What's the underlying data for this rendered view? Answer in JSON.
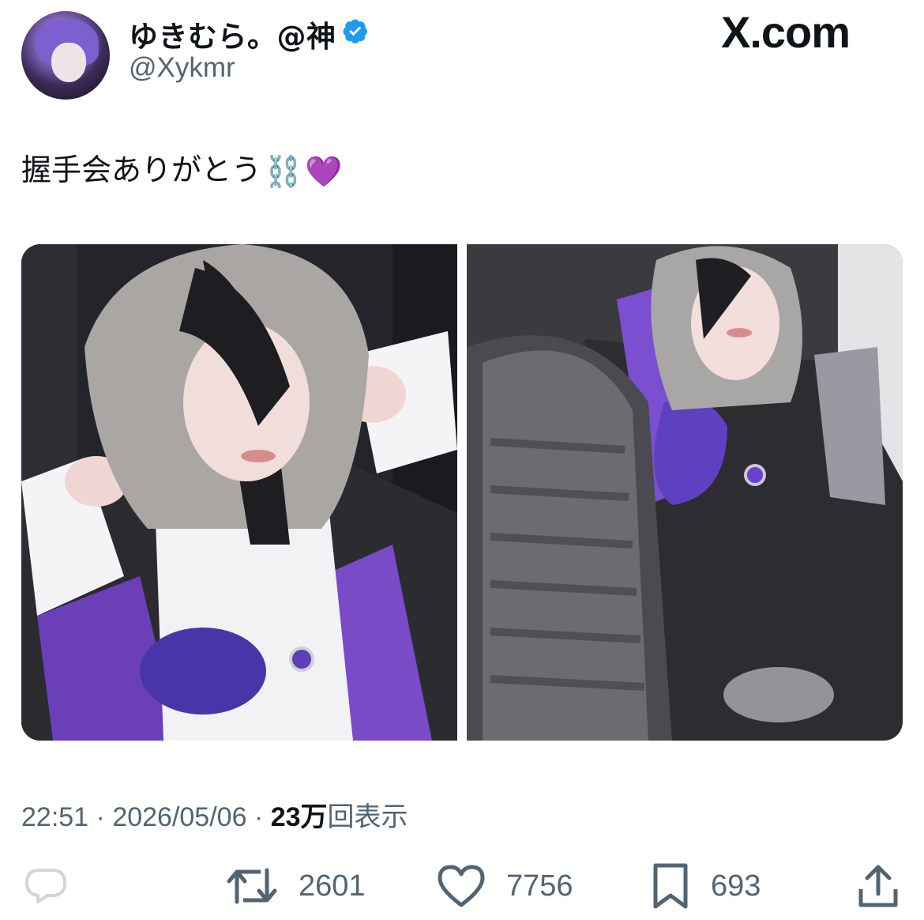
{
  "header": {
    "display_name": "ゆきむら。@神",
    "handle": "@Xykmr",
    "brand": "X.com"
  },
  "icons": {
    "verified": "verified-badge-icon",
    "reply": "reply-icon",
    "retweet": "retweet-icon",
    "like": "heart-icon",
    "bookmark": "bookmark-icon",
    "share": "share-icon"
  },
  "tweet": {
    "text": "握手会ありがとう",
    "emoji": [
      "⛓️",
      "💜"
    ]
  },
  "media": {
    "count": 2
  },
  "meta": {
    "time": "22:51",
    "separator": " · ",
    "date": "2026/05/06",
    "views_count": "23万",
    "views_label": "回表示"
  },
  "actions": {
    "retweets": "2601",
    "likes": "7756",
    "bookmarks": "693"
  },
  "colors": {
    "verified": "#1d9bf0",
    "muted": "#536471",
    "text": "#0f1419",
    "purple": "#8e58e8"
  }
}
